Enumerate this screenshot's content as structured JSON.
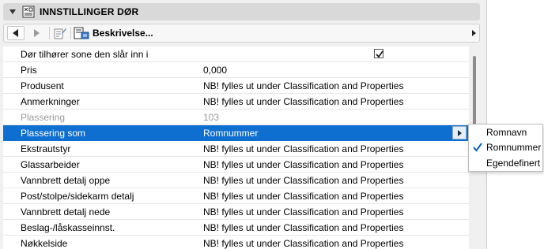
{
  "header": {
    "title": "INNSTILLINGER DØR"
  },
  "toolbar": {
    "description_label": "Beskrivelse..."
  },
  "rows": [
    {
      "name": "Dør tilhører sone den slår inn i",
      "value": "",
      "checkbox": true
    },
    {
      "name": "Pris",
      "value": "0,000"
    },
    {
      "name": "Produsent",
      "value": "NB! fylles ut under Classification and Properties"
    },
    {
      "name": "Anmerkninger",
      "value": "NB! fylles ut under Classification and Properties"
    },
    {
      "name": "Plassering",
      "value": "103",
      "disabled": true
    },
    {
      "name": "Plassering som",
      "value": "Romnummer",
      "selected": true
    },
    {
      "name": "Ekstrautstyr",
      "value": "NB! fylles ut under Classification and Properties"
    },
    {
      "name": "Glassarbeider",
      "value": "NB! fylles ut under Classification and Properties"
    },
    {
      "name": "Vannbrett detalj oppe",
      "value": "NB! fylles ut under Classification and Properties"
    },
    {
      "name": "Post/stolpe/sidekarm detalj",
      "value": "NB! fylles ut under Classification and Properties"
    },
    {
      "name": "Vannbrett detalj nede",
      "value": "NB! fylles ut under Classification and Properties"
    },
    {
      "name": "Beslag-/låskasseinnst.",
      "value": "NB! fylles ut under Classification and Properties"
    },
    {
      "name": "Nøkkelside",
      "value": "NB! fylles ut under Classification and Properties"
    }
  ],
  "dropdown": {
    "options": [
      {
        "label": "Romnavn",
        "checked": false
      },
      {
        "label": "Romnummer",
        "checked": true
      },
      {
        "label": "Egendefinert",
        "checked": false
      }
    ]
  },
  "colors": {
    "selection": "#0f6fd0",
    "header_bg": "#d9d9d9"
  }
}
